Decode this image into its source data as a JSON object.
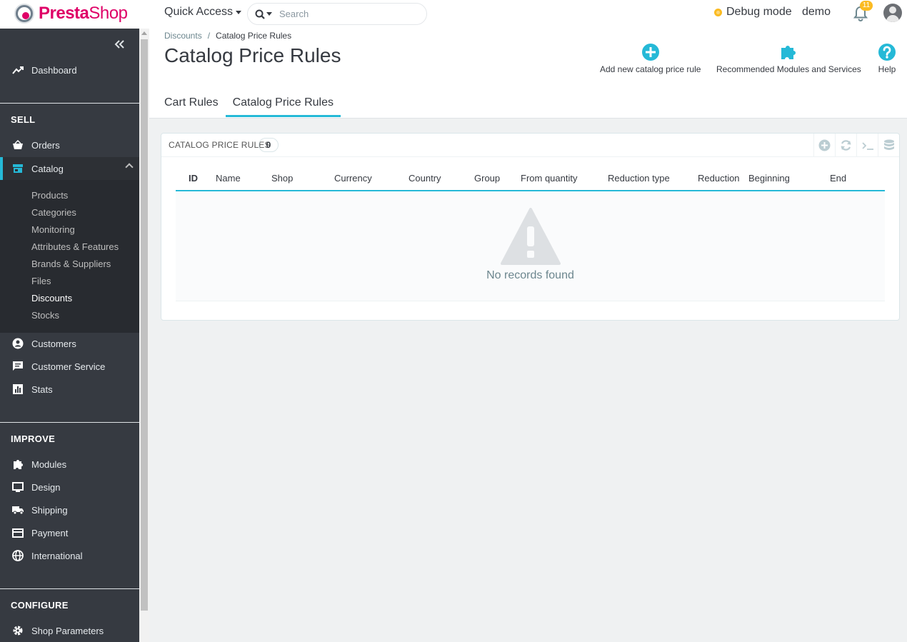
{
  "brand": {
    "name_part1": "Presta",
    "name_part2": "Shop"
  },
  "topbar": {
    "quick_access_label": "Quick Access",
    "search_placeholder": "Search",
    "debug_label": "Debug mode",
    "username": "demo",
    "notifications_count": "11"
  },
  "sidebar": {
    "dashboard": "Dashboard",
    "sections": {
      "sell": "SELL",
      "improve": "IMPROVE",
      "configure": "CONFIGURE"
    },
    "sell_items": {
      "orders": "Orders",
      "catalog": "Catalog",
      "customers": "Customers",
      "customer_service": "Customer Service",
      "stats": "Stats"
    },
    "catalog_sub": {
      "products": "Products",
      "categories": "Categories",
      "monitoring": "Monitoring",
      "attributes": "Attributes & Features",
      "brands": "Brands & Suppliers",
      "files": "Files",
      "discounts": "Discounts",
      "stocks": "Stocks"
    },
    "improve_items": {
      "modules": "Modules",
      "design": "Design",
      "shipping": "Shipping",
      "payment": "Payment",
      "international": "International"
    },
    "configure_items": {
      "shop_parameters": "Shop Parameters"
    }
  },
  "header": {
    "breadcrumb": {
      "parent": "Discounts",
      "separator": "/",
      "current": "Catalog Price Rules"
    },
    "title": "Catalog Price Rules",
    "toolbar": {
      "add_label": "Add new catalog price rule",
      "modules_label": "Recommended Modules and Services",
      "help_label": "Help"
    },
    "tabs": {
      "cart_rules": "Cart Rules",
      "catalog_price_rules": "Catalog Price Rules"
    }
  },
  "panel": {
    "title": "Catalog Price Rules",
    "count": "0",
    "columns": {
      "id": "ID",
      "name": "Name",
      "shop": "Shop",
      "currency": "Currency",
      "country": "Country",
      "group": "Group",
      "from_quantity": "From quantity",
      "reduction_type": "Reduction type",
      "reduction": "Reduction",
      "beginning": "Beginning",
      "end": "End"
    },
    "empty_text": "No records found"
  },
  "colors": {
    "accent": "#25b9d7",
    "sidebar_bg": "#363a41",
    "brand_pink": "#df0067",
    "debug_yellow": "#fbbb22"
  }
}
